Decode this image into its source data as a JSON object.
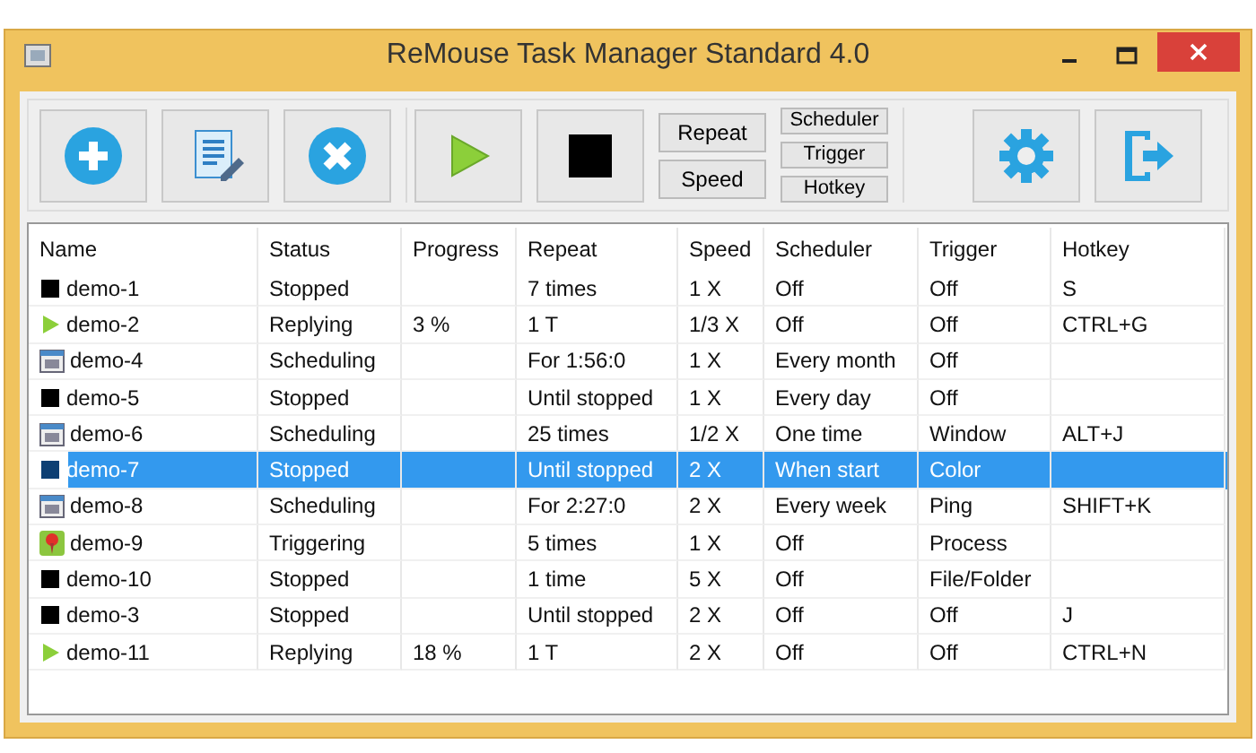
{
  "window": {
    "title": "ReMouse Task Manager Standard 4.0"
  },
  "toolbar": {
    "mode_buttons": [
      "Repeat",
      "Speed"
    ],
    "option_buttons": [
      "Scheduler",
      "Trigger",
      "Hotkey"
    ]
  },
  "table": {
    "columns": [
      "Name",
      "Status",
      "Progress",
      "Repeat",
      "Speed",
      "Scheduler",
      "Trigger",
      "Hotkey"
    ],
    "rows": [
      {
        "kind": "stopped",
        "selected": false,
        "cells": [
          "demo-1",
          "Stopped",
          "",
          "7 times",
          "1 X",
          "Off",
          "Off",
          "S"
        ]
      },
      {
        "kind": "replying",
        "selected": false,
        "cells": [
          "demo-2",
          "Replying",
          "3 %",
          "1 T",
          "1/3 X",
          "Off",
          "Off",
          "CTRL+G"
        ]
      },
      {
        "kind": "scheduling",
        "selected": false,
        "cells": [
          "demo-4",
          "Scheduling",
          "",
          "For 1:56:0",
          "1 X",
          "Every month",
          "Off",
          ""
        ]
      },
      {
        "kind": "stopped",
        "selected": false,
        "cells": [
          "demo-5",
          "Stopped",
          "",
          "Until stopped",
          "1 X",
          "Every day",
          "Off",
          ""
        ]
      },
      {
        "kind": "scheduling",
        "selected": false,
        "cells": [
          "demo-6",
          "Scheduling",
          "",
          "25 times",
          "1/2 X",
          "One time",
          "Window",
          "ALT+J"
        ]
      },
      {
        "kind": "stopped",
        "selected": true,
        "cells": [
          "demo-7",
          "Stopped",
          "",
          "Until stopped",
          "2 X",
          "When start",
          "Color",
          ""
        ]
      },
      {
        "kind": "scheduling",
        "selected": false,
        "cells": [
          "demo-8",
          "Scheduling",
          "",
          "For 2:27:0",
          "2 X",
          "Every week",
          "Ping",
          "SHIFT+K"
        ]
      },
      {
        "kind": "triggering",
        "selected": false,
        "cells": [
          "demo-9",
          "Triggering",
          "",
          "5 times",
          "1 X",
          "Off",
          "Process",
          ""
        ]
      },
      {
        "kind": "stopped",
        "selected": false,
        "cells": [
          "demo-10",
          "Stopped",
          "",
          "1 time",
          "5 X",
          "Off",
          "File/Folder",
          ""
        ]
      },
      {
        "kind": "stopped",
        "selected": false,
        "cells": [
          "demo-3",
          "Stopped",
          "",
          "Until stopped",
          "2 X",
          "Off",
          "Off",
          "J"
        ]
      },
      {
        "kind": "replying",
        "selected": false,
        "cells": [
          "demo-11",
          "Replying",
          "18 %",
          "1 T",
          "2 X",
          "Off",
          "Off",
          "CTRL+N"
        ]
      }
    ]
  }
}
